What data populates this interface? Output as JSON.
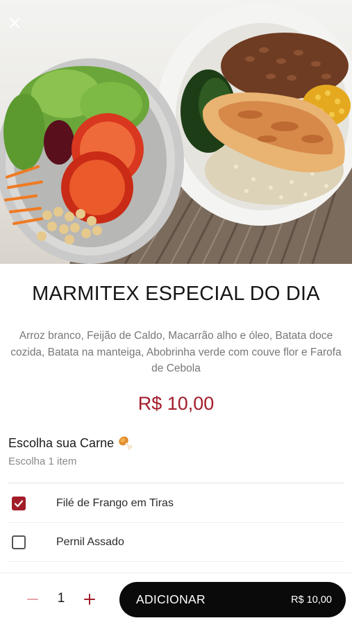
{
  "product": {
    "title": "MARMITEX ESPECIAL DO DIA",
    "description": "Arroz branco, Feijão de Caldo, Macarrão alho e óleo, Batata doce cozida, Batata na manteiga, Abobrinha verde com couve flor e Farofa de Cebola",
    "price": "R$ 10,00"
  },
  "option_group": {
    "title": "Escolha sua Carne",
    "title_icon": "drumstick-icon",
    "subtitle": "Escolha 1 item",
    "options": [
      {
        "label": "Filé de Frango em Tiras",
        "checked": true
      },
      {
        "label": "Pernil Assado",
        "checked": false
      }
    ]
  },
  "cart": {
    "quantity": "1",
    "add_label": "ADICIONAR",
    "add_price": "R$ 10,00"
  },
  "colors": {
    "accent": "#a31c2a",
    "button_bg": "#0a0a0a"
  }
}
